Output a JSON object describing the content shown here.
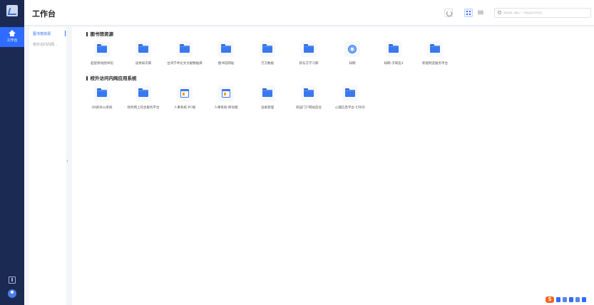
{
  "app": {
    "title": "工作台",
    "rail_item_label": "工作台"
  },
  "search": {
    "placeholder": "搜索应用，或输入一个网址进行打开访问"
  },
  "categories": [
    {
      "label": "图书馆资源",
      "active": true
    },
    {
      "label": "校外访问内网...",
      "active": false
    }
  ],
  "sections": [
    {
      "title": "图书馆资源",
      "apps": [
        {
          "label": "超星移动图书馆",
          "icon": "folder-icon"
        },
        {
          "label": "读秀知识库",
          "icon": "folder-icon"
        },
        {
          "label": "台湾学术论文文献数据库",
          "icon": "folder-icon"
        },
        {
          "label": "图书馆网站",
          "icon": "folder-icon"
        },
        {
          "label": "万方数据",
          "icon": "folder-icon"
        },
        {
          "label": "新东方学习库",
          "icon": "folder-icon"
        },
        {
          "label": "知网",
          "icon": "globe-icon"
        },
        {
          "label": "知网-子域名3",
          "icon": "folder-icon"
        },
        {
          "label": "新能制造服务平台",
          "icon": "folder-icon"
        }
      ]
    },
    {
      "title": "校外访问内网应用系统",
      "apps": [
        {
          "label": "OA即办公系统",
          "icon": "folder-icon"
        },
        {
          "label": "财务网上综合服务平台",
          "icon": "folder-icon"
        },
        {
          "label": "人事系统-PC端",
          "icon": "form-icon"
        },
        {
          "label": "人事系统-移动端",
          "icon": "form-icon"
        },
        {
          "label": "设备管理",
          "icon": "folder-icon"
        },
        {
          "label": "校园门户网站后台",
          "icon": "folder-icon"
        },
        {
          "label": "心理信息平台-引导页",
          "icon": "folder-icon"
        }
      ]
    }
  ],
  "colors": {
    "accent": "#2f6bff",
    "rail": "#1b2a52",
    "folder": "#3a78ef"
  }
}
